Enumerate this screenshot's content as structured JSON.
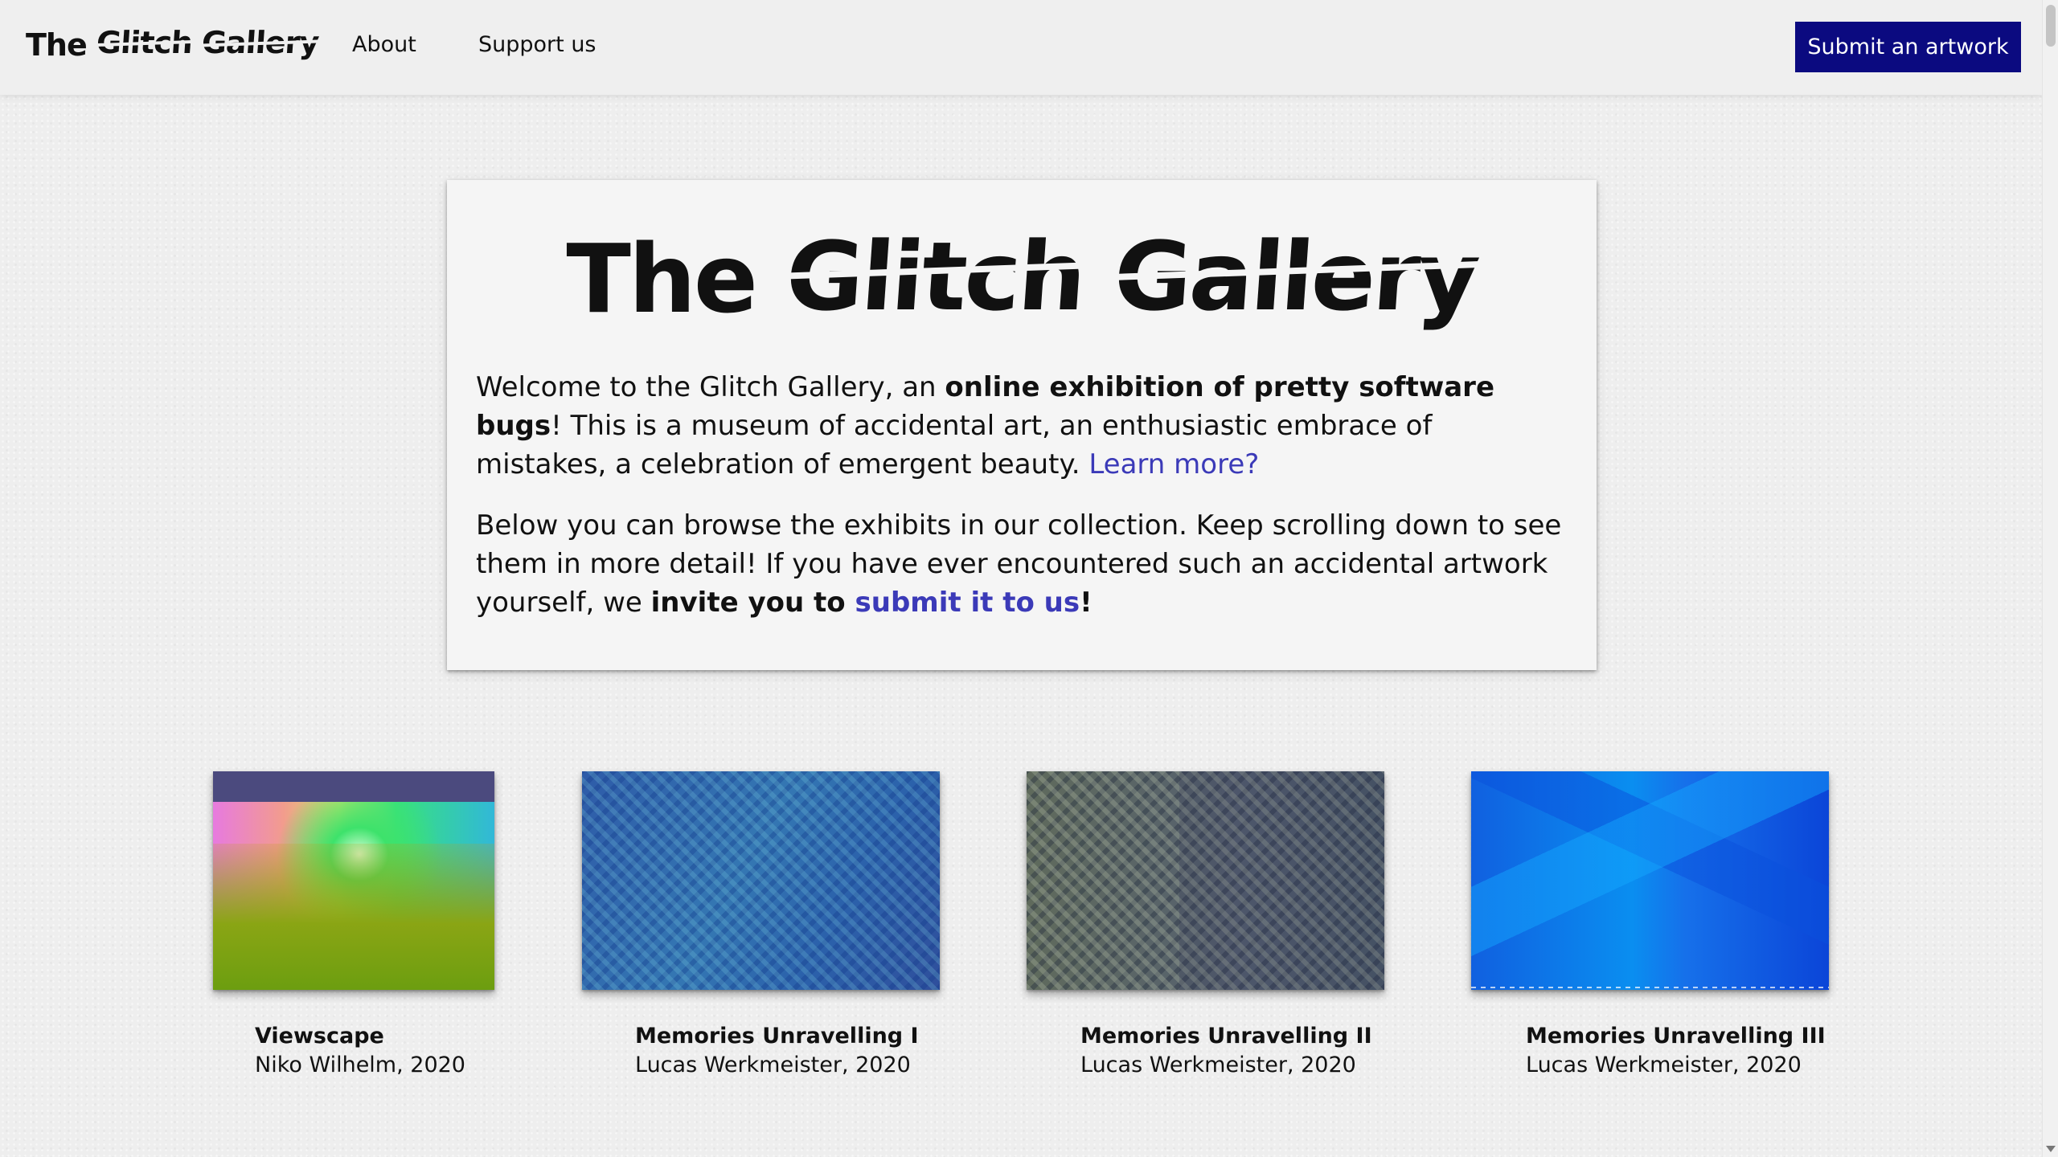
{
  "header": {
    "brand_first": "The ",
    "brand_glitch": "Glitch",
    "brand_space": " ",
    "brand_last": "Gallery",
    "nav": [
      {
        "label": "About"
      },
      {
        "label": "Support us"
      }
    ],
    "submit_label": "Submit an artwork"
  },
  "intro": {
    "title_first": "The ",
    "title_glitch": "Glitch",
    "title_space": " ",
    "title_last": "Gallery",
    "p1_a": "Welcome to the Glitch Gallery, an ",
    "p1_b": "online exhibition of pretty software bugs",
    "p1_c": "! This is a museum of accidental art, an enthusiastic embrace of mistakes, a celebration of emergent beauty. ",
    "p1_link": "Learn more?",
    "p2_a": "Below you can browse the exhibits in our collection. Keep scrolling down to see them in more detail! If you have ever encountered such an accidental artwork yourself, we ",
    "p2_b": "invite you to ",
    "p2_link": "submit it to us",
    "p2_c": "!"
  },
  "artworks": [
    {
      "title": "Viewscape",
      "artist": "Niko Wilhelm, 2020"
    },
    {
      "title": "Memories Unravelling I",
      "artist": "Lucas Werkmeister, 2020"
    },
    {
      "title": "Memories Unravelling II",
      "artist": "Lucas Werkmeister, 2020"
    },
    {
      "title": "Memories Unravelling III",
      "artist": "Lucas Werkmeister, 2020"
    }
  ],
  "colors": {
    "accent": "#0b0a80",
    "link": "#3b3ab8",
    "background": "#eeeeee"
  }
}
